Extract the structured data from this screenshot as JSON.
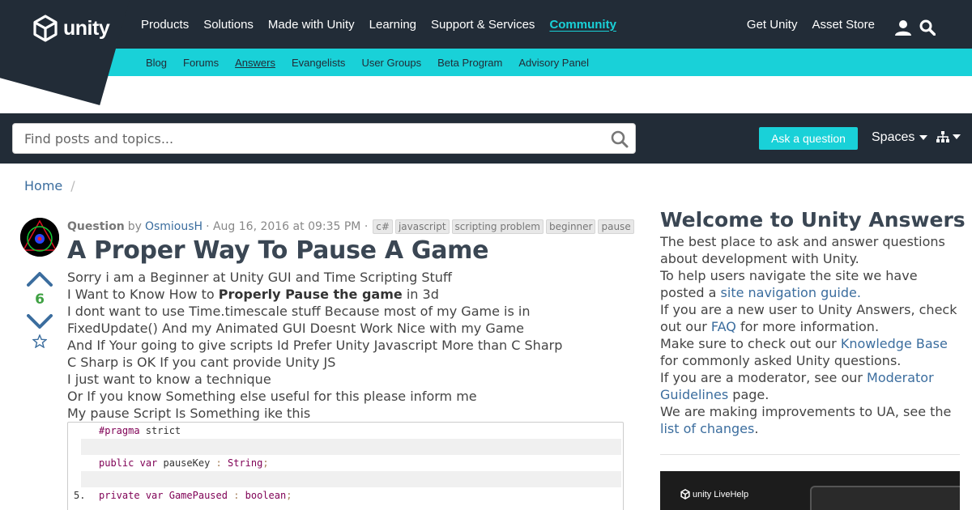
{
  "brand": {
    "name": "unity"
  },
  "mainnav": {
    "items": [
      "Products",
      "Solutions",
      "Made with Unity",
      "Learning",
      "Support & Services",
      "Community"
    ],
    "right": [
      "Get Unity",
      "Asset Store"
    ]
  },
  "subnav": {
    "items": [
      "Blog",
      "Forums",
      "Answers",
      "Evangelists",
      "User Groups",
      "Beta Program",
      "Advisory Panel"
    ]
  },
  "search": {
    "placeholder": "Find posts and topics..."
  },
  "toolbar": {
    "ask_label": "Ask a question",
    "spaces_label": "Spaces"
  },
  "breadcrumb": {
    "home": "Home",
    "sep": "/"
  },
  "question": {
    "label": "Question",
    "by": "by",
    "author": "OsmiousH",
    "date": "· Aug 16, 2016 at 09:35 PM ·",
    "tags": [
      "c#",
      "javascript",
      "scripting problem",
      "beginner",
      "pause"
    ],
    "title": "A Proper Way To Pause A Game",
    "votes": "6",
    "lines": {
      "l1": "Sorry i am a Beginner at Unity GUI and Time Scripting Stuff",
      "l2a": "I Want to Know How to ",
      "l2b": "Properly Pause the game",
      "l2c": " in 3d",
      "l3": "I dont want to use Time.timescale stuff Because most of my Game is in",
      "l4": "FixedUpdate() And my Animated GUI Doesnt Work Nice with my Game",
      "l5": "And If Your going to give scripts Id Prefer Unity Javascript More than C Sharp",
      "l6": "C Sharp is OK If you cant provide Unity JS",
      "l7": "I just want to know a technique",
      "l8": "Or If you know Something else useful for this please inform me",
      "l9": "My pause Script Is Something ike this"
    },
    "code": {
      "pragma": "#pragma",
      "strict": " strict",
      "public": "public",
      "var": "var",
      "pauseKey": " pauseKey ",
      "colon": ":",
      "stringType": " String",
      "semi": ";",
      "private": "private",
      "gamePaused": " GamePaused ",
      "booleanType": " boolean",
      "line5": "5."
    }
  },
  "sidebar": {
    "title": "Welcome to Unity Answers",
    "p1": "The best place to ask and answer questions about development with Unity.",
    "p2": "To help users navigate the site we have posted a ",
    "p2link": "site navigation guide",
    "p2end": ".",
    "p3": "If you are a new user to Unity Answers, check out our ",
    "p3link": "FAQ",
    "p3end": " for more information.",
    "p4": "Make sure to check out our ",
    "p4link": "Knowledge Base",
    "p4end": " for commonly asked Unity questions.",
    "p5": "If you are a moderator, see our ",
    "p5link": "Moderator Guidelines",
    "p5end": " page.",
    "p6": "We are making improvements to UA, see the ",
    "p6link": "list of changes",
    "p6end": ".",
    "promo": "unity LiveHelp"
  },
  "colors": {
    "navy": "#222c37",
    "cyan": "#19d1d8",
    "link": "#3b6d9e",
    "green": "#3fa143"
  }
}
